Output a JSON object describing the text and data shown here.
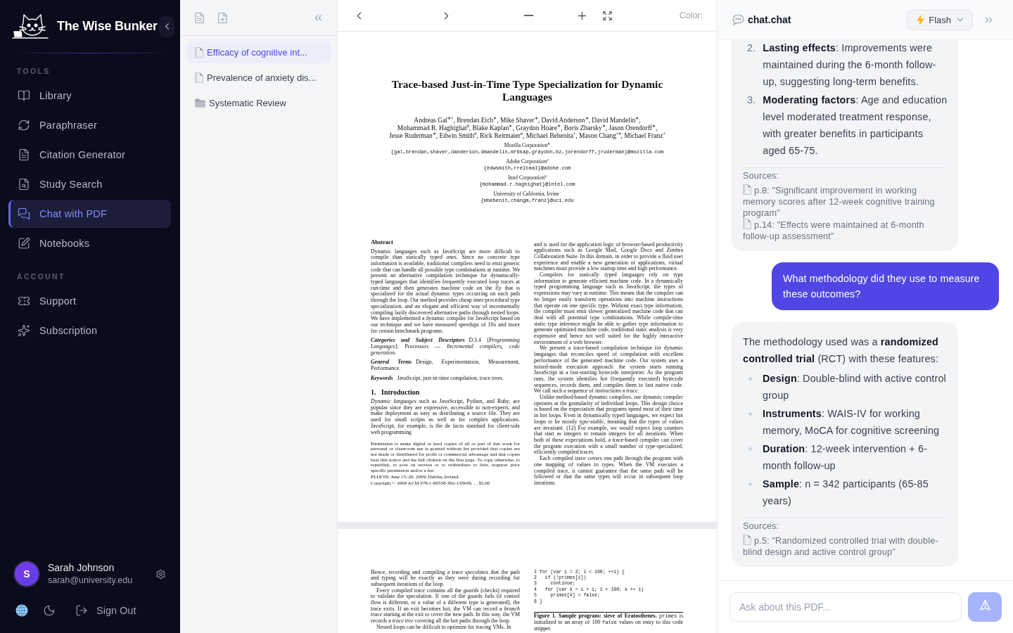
{
  "sidebar": {
    "brand": "The Wise Bunker",
    "sections": [
      {
        "heading": "TOOLS",
        "items": [
          {
            "label": "Library",
            "selected": false
          },
          {
            "label": "Paraphraser",
            "selected": false
          },
          {
            "label": "Citation Generator",
            "selected": false
          },
          {
            "label": "Study Search",
            "selected": false
          },
          {
            "label": "Chat with PDF",
            "selected": true
          },
          {
            "label": "Notebooks",
            "selected": false
          }
        ]
      },
      {
        "heading": "ACCOUNT",
        "items": [
          {
            "label": "Support",
            "selected": false
          },
          {
            "label": "Subscription",
            "selected": false
          }
        ]
      }
    ],
    "user": {
      "initial": "S",
      "name": "Sarah Johnson",
      "email": "sarah@university.edu"
    },
    "sign_out": "Sign Out"
  },
  "files": {
    "items": [
      {
        "kind": "file",
        "name": "Efficacy of cognitive int...",
        "selected": true
      },
      {
        "kind": "file",
        "name": "Prevalence of anxiety dis...",
        "selected": false
      },
      {
        "kind": "folder",
        "name": "Systematic Review",
        "selected": false
      }
    ]
  },
  "viewer": {
    "color_label": "Color:"
  },
  "document": {
    "title": "Trace-based Just-in-Time Type Specialization for Dynamic Languages",
    "author_lines": [
      "Andreas Gal$^{∗+}$, Brendan Eich$^{∗}$, Mike Shaver$^{∗}$, David Anderson$^{∗}$, David Mandelin$^{∗}$,",
      "Mohammad R. Haghighat$^{$}$, Blake Kaplan$^{∗}$, Graydon Hoare$^{∗}$, Boris Zbarsky$^{∗}$, Jason Orendorff$^{∗}$,",
      "Jesse Ruderman$^{∗}$, Edwin Smith$^{#}$, Rick Reitmaier$^{#}$, Michael Bebenita$^{+}$, Mason Chang$^{+#}$, Michael Franz$^{+}$"
    ],
    "affiliations": [
      {
        "name": "Mozilla Corporation$^{∗}$",
        "emails": "{gal,brendan,shaver,danderson,dmandelin,mrbkap,graydon,bz,jorendorff,jruderman}@mozilla.com"
      },
      {
        "name": "Adobe Corporation$^{#}$",
        "emails": "{edwsmith,rreitmai}@adobe.com"
      },
      {
        "name": "Intel Corporation$^{$}$",
        "emails": "{mohammad.r.haghighat}@intel.com"
      },
      {
        "name": "University of California, Irvine$^{+}$",
        "emails": "{mbebenit,changm,franz}@uci.edu"
      }
    ],
    "page_1": {
      "left_column": [
        {
          "kind": "heading",
          "text": "Abstract"
        },
        {
          "kind": "text",
          "text": "Dynamic languages such as JavaScript are more difficult to compile than statically typed ones. Since no concrete type information is available, traditional compilers need to emit generic code that can handle all possible type combinations at runtime. We present an alternative compilation technique for dynamically-typed languages that identifies frequently executed loop traces at run-time and then generates machine code on the fly that is specialized for the actual dynamic types occurring on each path through the loop. Our method provides cheap inter-procedural type specialization, and an elegant and efficient way of incrementally compiling lazily discovered alternative paths through nested loops. We have implemented a dynamic compiler for JavaScript based on our technique and we have measured speedups of 10x and more for certain benchmark programs."
        },
        {
          "kind": "term",
          "term": "Categories and Subject Descriptors",
          "text": "D.3.4 [*Programming Languages*]: Processors — *Incremental compilers, code generation.*"
        },
        {
          "kind": "term",
          "term": "General Terms",
          "text": "Design, Experimentation, Measurement, Performance."
        },
        {
          "kind": "term",
          "term": "Keywords",
          "text": "JavaScript, just-in-time compilation, trace trees."
        },
        {
          "kind": "section",
          "text": "1. Introduction"
        },
        {
          "kind": "text",
          "text": "*Dynamic languages* such as JavaScript, Python, and Ruby, are popular since they are expressive, accessible to non-experts, and make deployment as easy as distributing a source file. They are used for small scripts as well as for complex applications. JavaScript, for example, is the de facto standard for client-side web programming"
        },
        {
          "kind": "fineprint",
          "text": "Permission to make digital or hard copies of all or part of this work for personal or classroom use is granted without fee provided that copies are not made or distributed for profit or commercial advantage and that copies bear this notice and the full citation on the first page. To copy otherwise, to republish, to post on servers or to redistribute to lists, requires prior specific permission and/or a fee."
        },
        {
          "kind": "venue",
          "text": "*PLDI’09,* June 15–20, 2009, Dublin, Ireland."
        },
        {
          "kind": "venue",
          "text": "Copyright © 2009 ACM 978-1-60558-392-1/09/06. . . $5.00"
        }
      ],
      "right_column": [
        {
          "kind": "text",
          "text": "and is used for the application logic of browser-based productivity applications such as Google Mail, Google Docs and Zimbra Collaboration Suite. In this domain, in order to provide a fluid user experience and enable a new generation of applications, virtual machines must provide a low startup time and high performance."
        },
        {
          "kind": "indented",
          "text": "Compilers for statically typed languages rely on type information to generate efficient machine code. In a dynamically typed programming language such as JavaScript, the types of expressions may vary at runtime. This means that the compiler can no longer easily transform operations into machine instructions that operate on one specific type. Without exact type information, the compiler must emit slower generalized machine code that can deal with all potential type combinations. While compile-time static type inference might be able to gather type information to generate optimized machine code, traditional static analysis is very expensive and hence not well suited for the highly interactive environment of a web browser."
        },
        {
          "kind": "indented",
          "text": "We present a trace-based compilation technique for dynamic languages that reconciles speed of compilation with excellent performance of the generated machine code. Our system uses a mixed-mode execution approach: the system starts running JavaScript in a fast-starting bytecode interpreter. As the program runs, the system identifies *hot* (frequently executed) bytecode sequences, records them, and compiles them to fast native code. We call such a sequence of instructions a *trace*."
        },
        {
          "kind": "indented",
          "text": "Unlike method-based dynamic compilers, our dynamic compiler operates at the granularity of individual loops. This design choice is based on the expectation that programs spend most of their time in hot loops. Even in dynamically typed languages, we expect hot loops to be mostly *type-stable*, meaning that the types of values are invariant. (12) For example, we would expect loop counters that start as integers to remain integers for all iterations. When both of these expectations hold, a trace-based compiler can cover the program execution with a small number of type-specialized, efficiently compiled traces."
        },
        {
          "kind": "indented",
          "text": "Each compiled trace covers one path through the program with one mapping of values to types. When the VM executes a compiled trace, it cannot guarantee that the same path will be followed or that the same types will occur in subsequent loop iterations."
        }
      ]
    },
    "page_2": {
      "left_column": [
        {
          "kind": "text",
          "text": "Hence, recording and compiling a trace *speculates* that the path and typing will be exactly as they were during recording for subsequent iterations of the loop."
        },
        {
          "kind": "indented",
          "text": "Every compiled trace contains all the *guards* (checks) required to validate the speculation. If one of the guards fails (if control flow is different, or a value of a different type is generated), the trace exits. If an exit becomes hot, the VM can record a *branch trace* starting at the exit to cover the new path. In this way, the VM records a *trace tree* covering all the hot paths through the loop."
        },
        {
          "kind": "indented",
          "text": "Nested loops can be difficult to optimize for tracing VMs. In"
        }
      ],
      "code": [
        {
          "number": "1",
          "code": "for (var i = 2; i < 100; ++i) {"
        },
        {
          "number": "2",
          "code": "  if (!primes[i])"
        },
        {
          "number": "3",
          "code": "    continue;"
        },
        {
          "number": "4",
          "code": "  for (var k = i + i; i < 100; k += i)"
        },
        {
          "number": "5",
          "code": "    primes[k] = false;"
        },
        {
          "number": "6",
          "code": "}"
        }
      ],
      "caption": [
        {
          "kind": "bold",
          "text": "Figure 1. Sample program: sieve of Eratosthenes."
        },
        {
          "kind": "mono",
          "text": "primes"
        },
        {
          "kind": "plain",
          "text": "is initialized to an array of 100"
        },
        {
          "kind": "mono",
          "text": "false"
        },
        {
          "kind": "plain",
          "text": "values on entry to this code snippet."
        }
      ]
    }
  },
  "chat": {
    "title": "chat.chat",
    "model_select": {
      "value": "Flash"
    },
    "messages": [
      {
        "kind": "assistant",
        "list": [
          {
            "kind": "numbered",
            "marker": "2.",
            "text": "**Lasting effects**: Improvements were maintained during the 6-month follow-up, suggesting long-term benefits."
          },
          {
            "kind": "numbered",
            "marker": "3.",
            "text": "**Moderating factors**: Age and education level moderated treatment response, with greater benefits in participants aged 65-75."
          }
        ],
        "sources_label": "Sources:",
        "sources": [
          "p.8: \"Significant improvement in working memory scores after 12-week cognitive training program\"",
          "p.14: \"Effects were maintained at 6-month follow-up assessment\""
        ]
      },
      {
        "kind": "user",
        "text": "What methodology did they use to measure these outcomes?"
      },
      {
        "kind": "assistant",
        "intro": "The methodology used was a **randomized controlled trial** (RCT) with these features:",
        "list": [
          {
            "kind": "bullet",
            "text": "**Design**: Double-blind with active control group"
          },
          {
            "kind": "bullet",
            "text": "**Instruments**: WAIS-IV for working memory, MoCA for cognitive screening"
          },
          {
            "kind": "bullet",
            "text": "**Duration**: 12-week intervention + 6-month follow-up"
          },
          {
            "kind": "bullet",
            "text": "**Sample**: n = 342 participants (65-85 years)"
          }
        ],
        "sources_label": "Sources:",
        "sources": [
          "p.5: \"Randomized controlled trial with double-blind design and active control group\""
        ]
      }
    ],
    "input": {
      "placeholder": "Ask about this PDF..."
    },
    "send": {
      "disabled": true
    }
  }
}
